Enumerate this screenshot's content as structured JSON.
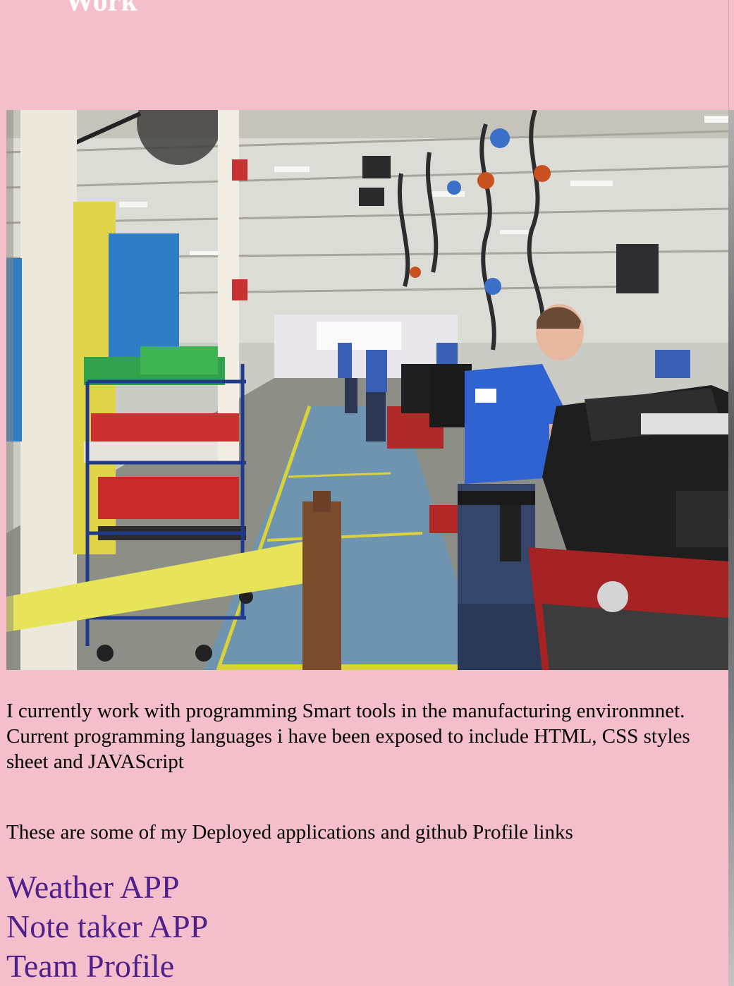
{
  "header": {
    "title": "Work"
  },
  "hero_image": {
    "description_icon": "factory-assembly-line-photo"
  },
  "content": {
    "work_paragraph": "I currently work with programming Smart tools in the manufacturing environmnet. Current programming languages i have been exposed to include HTML, CSS styles sheet and JAVAScript",
    "links_intro": "These are some of my Deployed applications and github Profile links"
  },
  "links": [
    {
      "label": "Weather APP"
    },
    {
      "label": "Note taker APP"
    },
    {
      "label": "Team Profile"
    }
  ],
  "colors": {
    "background": "#f4bfca",
    "link": "#4f1f8c",
    "heading": "#ffffff"
  }
}
